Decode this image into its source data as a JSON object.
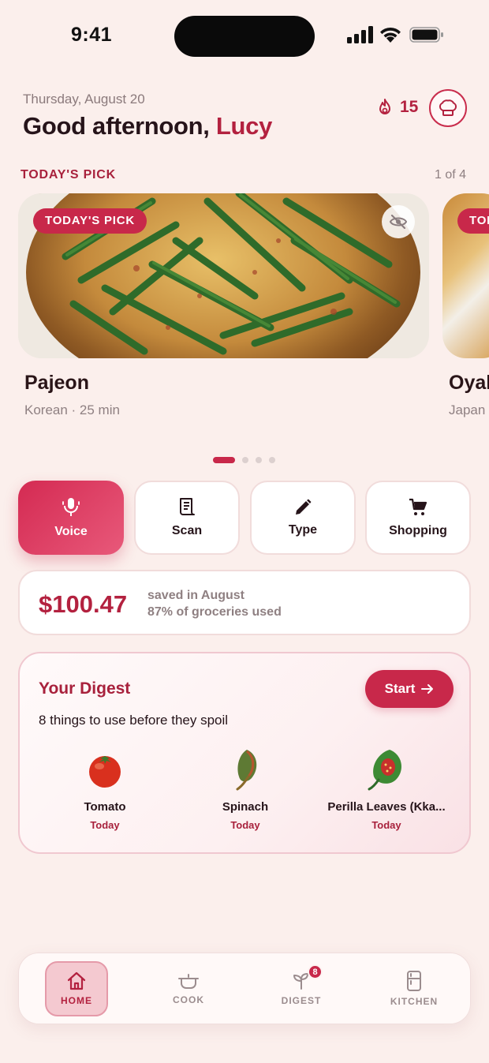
{
  "status_bar": {
    "time": "9:41"
  },
  "header": {
    "date": "Thursday, August 20",
    "greeting": "Good afternoon, ",
    "user_name": "Lucy",
    "streak_count": "15"
  },
  "carousel": {
    "section_label": "TODAY'S PICK",
    "page_indicator": "1 of 4",
    "active_index": 0,
    "total": 4,
    "cards": [
      {
        "badge": "TODAY'S PICK",
        "name": "Pajeon",
        "meta": "Korean · 25 min"
      },
      {
        "badge": "TOD",
        "name": "Oyal",
        "meta": "Japan"
      }
    ]
  },
  "actions": [
    {
      "label": "Voice",
      "icon": "microphone-icon"
    },
    {
      "label": "Scan",
      "icon": "receipt-icon"
    },
    {
      "label": "Type",
      "icon": "pencil-icon"
    },
    {
      "label": "Shopping",
      "icon": "cart-icon"
    }
  ],
  "savings": {
    "amount": "$100.47",
    "line1": "saved in August",
    "line2": "87% of groceries used"
  },
  "digest": {
    "title": "Your Digest",
    "subtitle": "8 things to use before they spoil",
    "start_label": "Start",
    "items": [
      {
        "name": "Tomato",
        "when": "Today",
        "icon": "tomato-icon"
      },
      {
        "name": "Spinach",
        "when": "Today",
        "icon": "spinach-icon"
      },
      {
        "name": "Perilla Leaves (Kka...",
        "when": "Today",
        "icon": "perilla-leaf-icon"
      }
    ]
  },
  "tabbar": {
    "items": [
      {
        "label": "HOME",
        "icon": "home-icon",
        "active": true
      },
      {
        "label": "COOK",
        "icon": "pot-icon",
        "active": false
      },
      {
        "label": "DIGEST",
        "icon": "sprout-icon",
        "active": false,
        "badge": "8"
      },
      {
        "label": "KITCHEN",
        "icon": "fridge-icon",
        "active": false
      }
    ]
  },
  "colors": {
    "accent": "#c8284a",
    "background": "#fbefec",
    "text": "#26141a",
    "muted": "#8f8082"
  }
}
